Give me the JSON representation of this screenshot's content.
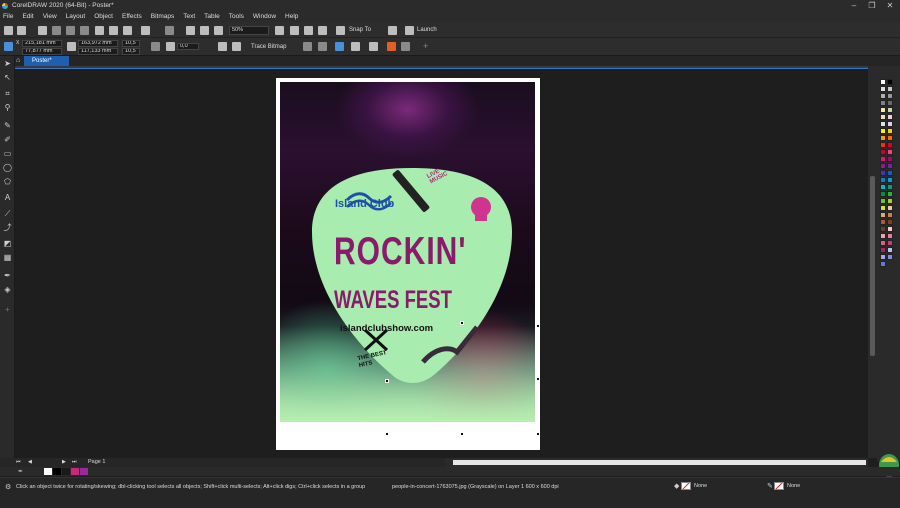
{
  "window": {
    "title": "CorelDRAW 2020 (64-Bit) - Poster*",
    "controls": [
      "–",
      "❐",
      "✕"
    ]
  },
  "menu": [
    "File",
    "Edit",
    "View",
    "Layout",
    "Object",
    "Effects",
    "Bitmaps",
    "Text",
    "Table",
    "Tools",
    "Window",
    "Help"
  ],
  "toolbar": {
    "zoom": "50%",
    "snap_to": "Snap To",
    "launch": "Launch"
  },
  "property_bar": {
    "x": "215,181 mm",
    "y": "77,877 mm",
    "width": "163,972 mm",
    "height": "117,133 mm",
    "scale_x": "10,5",
    "scale_y": "10,5",
    "rotation": "0,0",
    "trace_bitmap": "Trace Bitmap"
  },
  "doc_tab": "Poster*",
  "poster": {
    "brand": "Island Club",
    "headline_1": "ROCKIN'",
    "headline_2": "WAVES FEST",
    "website": "islandclubshow.com",
    "badge": "LIVE MUSIC",
    "tagline": "THE BEST HITS"
  },
  "page_nav": {
    "page_label": "Page 1"
  },
  "status": {
    "message": "Click an object twice for rotating/skewing; dbl-clicking tool selects all objects; Shift+click multi-selects; Alt+click digs; Ctrl+click selects in a group",
    "object_info": "people-in-concert-1763075.jpg (Grayscale) on Layer 1 600 x 600 dpi",
    "fill": "None",
    "outline": "None"
  },
  "colors": {
    "accent": "#1f5fae",
    "poster_green": "#a8ecb0",
    "poster_magenta": "#8a1a6a",
    "pick_text": "#8a1a6a"
  },
  "palette_colors": [
    "#ffffff",
    "#000000",
    "#e0e0e0",
    "#c8c8c8",
    "#b0b0b0",
    "#989898",
    "#808080",
    "#686868",
    "#f5e6a8",
    "#c8d8a0",
    "#e8e0c0",
    "#f0d0d8",
    "#d0e8f0",
    "#e0d0f0",
    "#f8f000",
    "#ffd000",
    "#ff9900",
    "#ff6a00",
    "#ff3000",
    "#e00020",
    "#c8002a",
    "#ff3c8c",
    "#e01478",
    "#b0006e",
    "#8c1a8c",
    "#6a2aa8",
    "#3a3ab8",
    "#1a5ac8",
    "#0080d0",
    "#00a0e0",
    "#00b8c8",
    "#00a080",
    "#009040",
    "#30b030",
    "#70c030",
    "#a8d020",
    "#d0e030",
    "#f0c8a0",
    "#e0a878",
    "#c88050",
    "#a06030",
    "#804020",
    "#604030",
    "#f8c8c8",
    "#f0a0b0",
    "#e88098",
    "#d86080",
    "#c04070",
    "#a02858",
    "#c0c0f0",
    "#a0a8e8",
    "#8090e0",
    "#6878d0"
  ]
}
